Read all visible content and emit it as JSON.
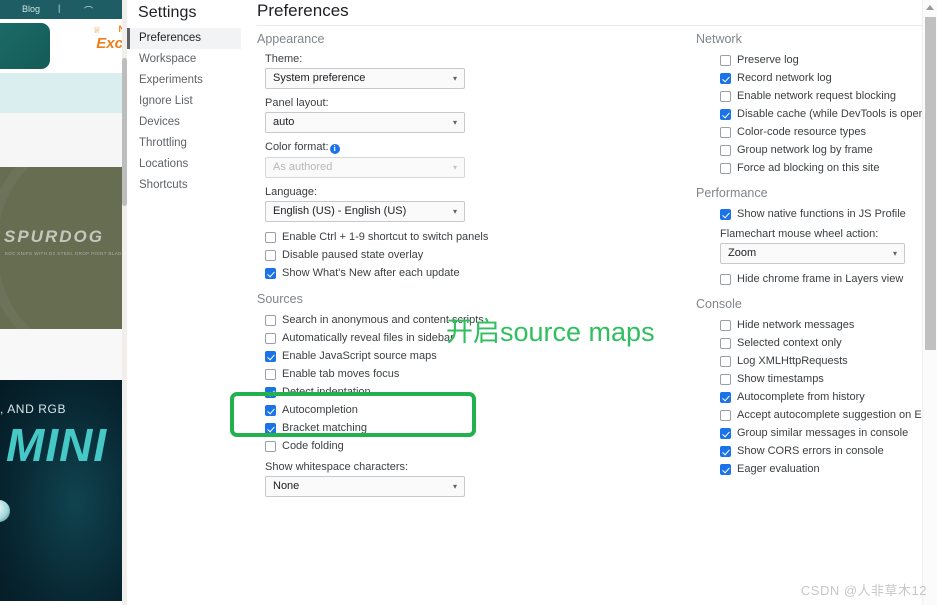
{
  "background_page": {
    "nav_items": [
      "Blog",
      "Cart"
    ],
    "promo_badge": "N",
    "promo_text": "Exc",
    "brand_wordmark": "SPURDOG",
    "brand_tagline": "EDC KNIFE WITH D2 STEEL DROP POINT BLADE",
    "banner_kicker": ", AND RGB",
    "banner_title": "MINI"
  },
  "sidebar": {
    "title": "Settings",
    "items": [
      {
        "label": "Preferences",
        "active": true
      },
      {
        "label": "Workspace",
        "active": false
      },
      {
        "label": "Experiments",
        "active": false
      },
      {
        "label": "Ignore List",
        "active": false
      },
      {
        "label": "Devices",
        "active": false
      },
      {
        "label": "Throttling",
        "active": false
      },
      {
        "label": "Locations",
        "active": false
      },
      {
        "label": "Shortcuts",
        "active": false
      }
    ]
  },
  "pane": {
    "title": "Preferences"
  },
  "appearance": {
    "heading": "Appearance",
    "theme_label": "Theme:",
    "theme_value": "System preference",
    "panel_layout_label": "Panel layout:",
    "panel_layout_value": "auto",
    "color_format_label": "Color format:",
    "color_format_value": "As authored",
    "language_label": "Language:",
    "language_value": "English (US) - English (US)",
    "checkboxes": [
      {
        "label": "Enable Ctrl + 1-9 shortcut to switch panels",
        "checked": false
      },
      {
        "label": "Disable paused state overlay",
        "checked": false
      },
      {
        "label": "Show What's New after each update",
        "checked": true
      }
    ]
  },
  "sources": {
    "heading": "Sources",
    "checkboxes": [
      {
        "label": "Search in anonymous and content scripts",
        "checked": false
      },
      {
        "label": "Automatically reveal files in sidebar",
        "checked": false
      },
      {
        "label": "Enable JavaScript source maps",
        "checked": true
      },
      {
        "label": "Enable tab moves focus",
        "checked": false
      },
      {
        "label": "Detect indentation",
        "checked": true
      },
      {
        "label": "Autocompletion",
        "checked": true
      },
      {
        "label": "Bracket matching",
        "checked": true
      },
      {
        "label": "Code folding",
        "checked": false
      }
    ],
    "whitespace_label": "Show whitespace characters:",
    "whitespace_value": "None"
  },
  "network": {
    "heading": "Network",
    "checkboxes": [
      {
        "label": "Preserve log",
        "checked": false
      },
      {
        "label": "Record network log",
        "checked": true
      },
      {
        "label": "Enable network request blocking",
        "checked": false
      },
      {
        "label": "Disable cache (while DevTools is open)",
        "checked": true
      },
      {
        "label": "Color-code resource types",
        "checked": false
      },
      {
        "label": "Group network log by frame",
        "checked": false
      },
      {
        "label": "Force ad blocking on this site",
        "checked": false
      }
    ]
  },
  "performance": {
    "heading": "Performance",
    "checkboxes_top": [
      {
        "label": "Show native functions in JS Profile",
        "checked": true
      }
    ],
    "flamechart_label": "Flamechart mouse wheel action:",
    "flamechart_value": "Zoom",
    "checkboxes_bottom": [
      {
        "label": "Hide chrome frame in Layers view",
        "checked": false
      }
    ]
  },
  "console": {
    "heading": "Console",
    "checkboxes": [
      {
        "label": "Hide network messages",
        "checked": false
      },
      {
        "label": "Selected context only",
        "checked": false
      },
      {
        "label": "Log XMLHttpRequests",
        "checked": false
      },
      {
        "label": "Show timestamps",
        "checked": false
      },
      {
        "label": "Autocomplete from history",
        "checked": true
      },
      {
        "label": "Accept autocomplete suggestion on Enter",
        "checked": false
      },
      {
        "label": "Group similar messages in console",
        "checked": true
      },
      {
        "label": "Show CORS errors in console",
        "checked": true
      },
      {
        "label": "Eager evaluation",
        "checked": true
      }
    ]
  },
  "annotation": {
    "text": "开启source maps",
    "color": "#2fbf5f"
  },
  "watermark": {
    "text": "CSDN @人非草木12"
  },
  "colors": {
    "accent_blue": "#1a73e8",
    "annotation_green": "#22b14c",
    "active_nav_bg": "#f1f3f4"
  }
}
